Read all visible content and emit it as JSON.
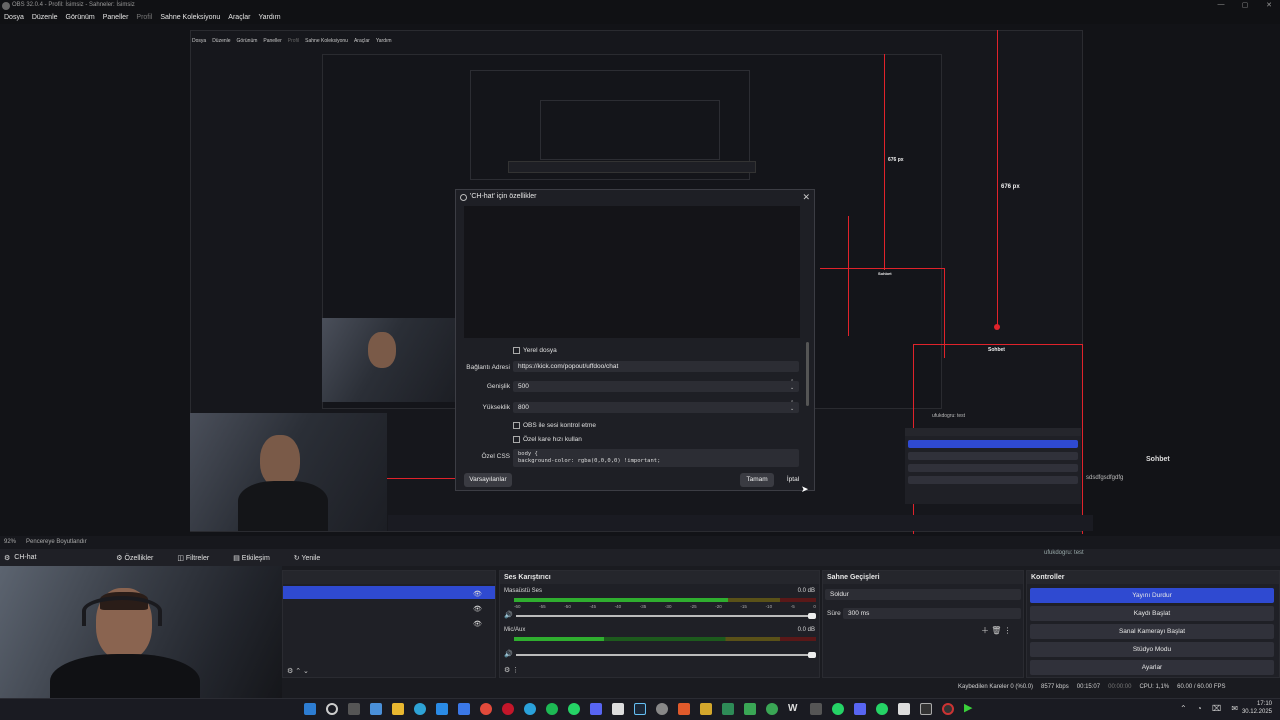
{
  "window": {
    "title": "OBS 32.0.4 - Profil: İsimsiz - Sahneler: İsimsiz",
    "min_label": "—",
    "max_label": "▢",
    "close_label": "✕"
  },
  "menu": [
    "Dosya",
    "Düzenle",
    "Görünüm",
    "Paneller",
    "Profil",
    "Sahne Koleksiyonu",
    "Araçlar",
    "Yardım"
  ],
  "nested_menu": [
    "Dosya",
    "Düzenle",
    "Görünüm",
    "Paneller",
    "Profil",
    "Sahne Koleksiyonu",
    "Araçlar",
    "Yardım"
  ],
  "preview_labels": {
    "px676_large": "676 px",
    "px676_small": "676 px",
    "sohbet_1": "Sohbet",
    "sohbet_2": "Sohbet",
    "sohbet_main": "Sohbet",
    "chat_user": "ufukdogru: test",
    "chat_user_small": "ufukdogru: test",
    "chat_spam": "sdsdfgsdfgdfg"
  },
  "dialog": {
    "title": "'CH-hat' için özellikler",
    "local_file_label": "Yerel dosya",
    "url_label": "Bağlantı Adresi",
    "url_value": "https://kick.com/popout/uffdoo/chat",
    "width_label": "Genişlik",
    "width_value": "500",
    "height_label": "Yükseklik",
    "height_value": "800",
    "obs_audio_label": "OBS ile sesi kontrol etme",
    "custom_fps_label": "Özel kare hızı kullan",
    "css_label": "Özel CSS",
    "css_line1": "body {",
    "css_line2": "  background-color: rgba(0,0,0,0) !important;",
    "defaults_button": "Varsayılanlar",
    "ok_button": "Tamam",
    "cancel_button": "İptal"
  },
  "preview_status": {
    "zoom": "92%",
    "mode": "Pencereye Boyutlandır"
  },
  "source_bar": {
    "source_name": "CH-hat",
    "properties": "Özellikler",
    "filters": "Filtreler",
    "interact": "Etkileşim",
    "refresh": "Yenile"
  },
  "mixer": {
    "title": "Ses Karıştırıcı",
    "channels": [
      {
        "name": "Masaüstü Ses",
        "db": "0.0 dB",
        "level": 0.72
      },
      {
        "name": "Mic/Aux",
        "db": "0.0 dB",
        "level": 0.32
      }
    ],
    "ticks": [
      "-60",
      "-55",
      "-50",
      "-45",
      "-40",
      "-35",
      "-30",
      "-25",
      "-20",
      "-15",
      "-10",
      "-5",
      "0"
    ]
  },
  "transitions": {
    "title": "Sahne Geçişleri",
    "selected": "Soldur",
    "duration_label": "Süre",
    "duration_value": "300 ms"
  },
  "controls": {
    "title": "Kontroller",
    "buttons": [
      "Yayını Durdur",
      "Kaydı Başlat",
      "Sanal Kamerayı Başlat",
      "Stüdyo Modu",
      "Ayarlar"
    ]
  },
  "status": {
    "dropped": "Kaybedilen Kareler 0 (%0.0)",
    "bitrate": "8577 kbps",
    "stream_time": "00:15:07",
    "rec_time": "00:00:00",
    "cpu": "CPU: 1,1%",
    "fps": "60.00 / 60.00 FPS"
  },
  "tray": {
    "time": "17:10",
    "date": "30.12.2025"
  },
  "colors": {
    "accent": "#2f4ad1",
    "red_guide": "#e0232b",
    "meter_green": "#2fae2f",
    "meter_yellow": "#b6a42a",
    "meter_red": "#b8262c"
  }
}
